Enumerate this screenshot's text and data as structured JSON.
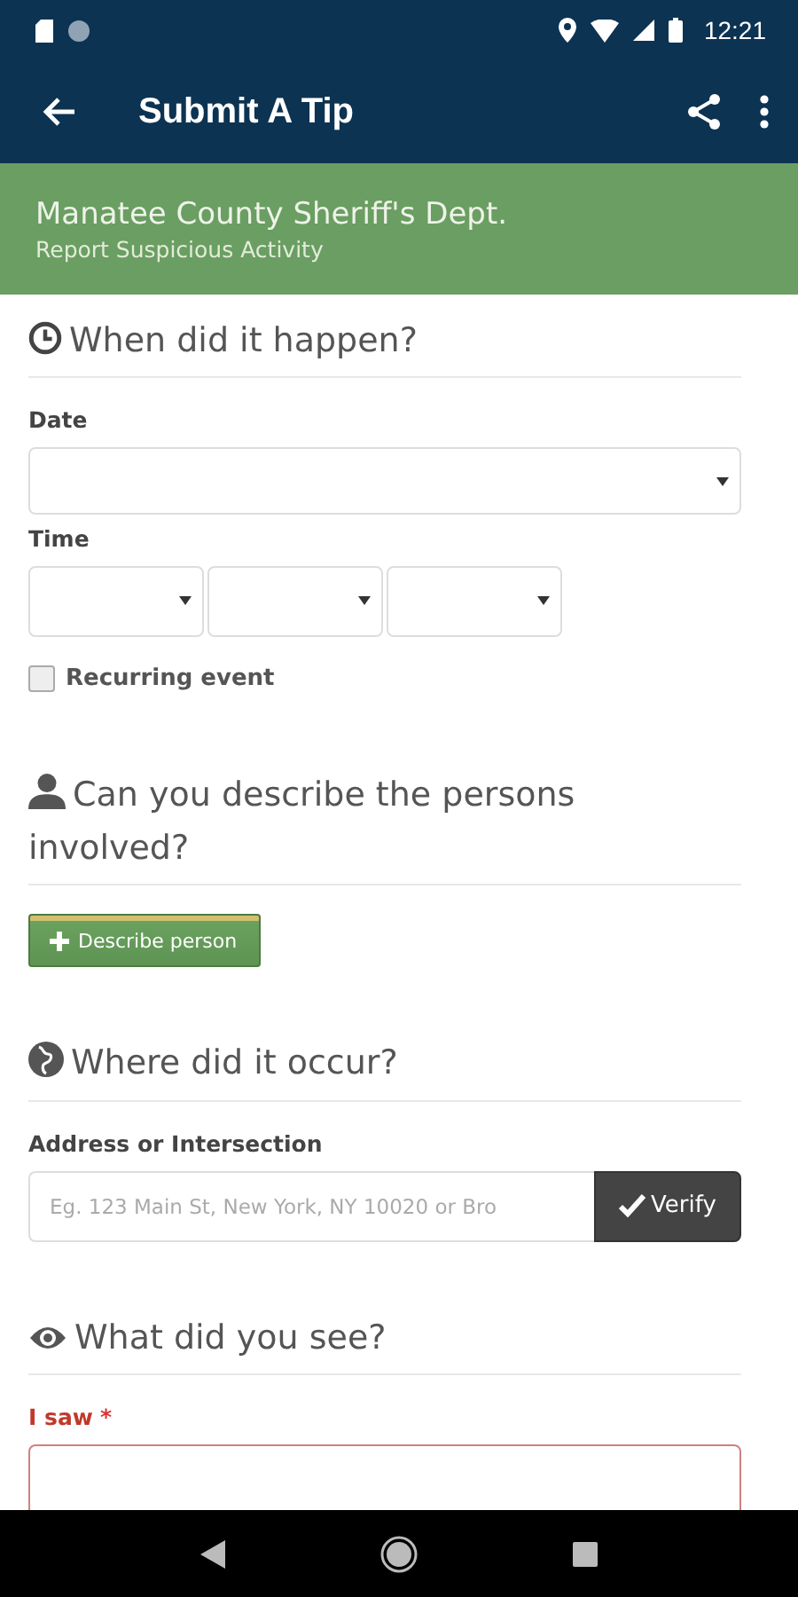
{
  "status_bar": {
    "time": "12:21"
  },
  "app_bar": {
    "title": "Submit A Tip"
  },
  "banner": {
    "title": "Manatee County Sheriff's Dept.",
    "subtitle": "Report Suspicious Activity"
  },
  "sections": [
    {
      "kind": "time",
      "heading": "When did it happen?",
      "fields": [
        {
          "kind": "select",
          "label": "Date"
        },
        {
          "kind": "select_row",
          "label": "Time",
          "dropdowns": [
            {
              "kind": "select"
            },
            {
              "kind": "select"
            },
            {
              "kind": "select"
            }
          ]
        },
        {
          "kind": "checkbox",
          "label": "Recurring event",
          "checked": false
        }
      ]
    },
    {
      "kind": "persons",
      "heading": "Can you describe the persons involved?",
      "fields": [
        {
          "kind": "button",
          "label": "Describe person"
        }
      ]
    },
    {
      "kind": "location",
      "heading": "Where did it occur?",
      "fields": [
        {
          "kind": "address",
          "label": "Address or Intersection",
          "placeholder": "Eg. 123 Main St, New York, NY 10020 or Bro",
          "button": "Verify"
        }
      ]
    },
    {
      "kind": "description",
      "heading": "What did you see?",
      "fields": [
        {
          "kind": "textarea",
          "label": "I saw",
          "required": true,
          "required_mark": "*"
        }
      ]
    }
  ]
}
